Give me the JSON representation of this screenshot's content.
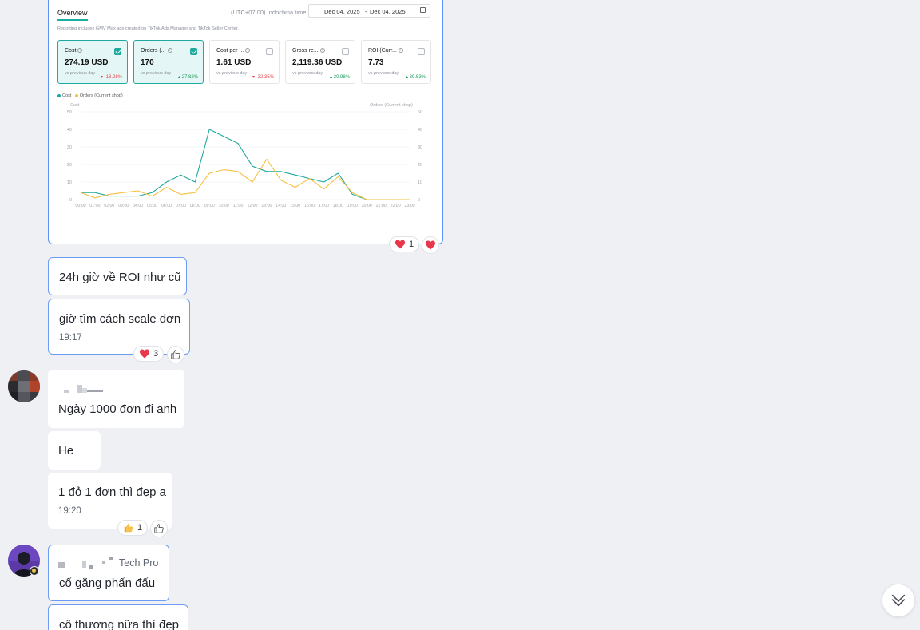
{
  "screenshot_card": {
    "overview_tab": "Overview",
    "timezone": "(UTC+07:00) Indochina time",
    "date_start": "Dec 04, 2025",
    "date_sep": "-",
    "date_end": "Dec 04, 2025",
    "reporting_note": "Reporting includes GMV Max ads created on TikTok Ads Manager and TikTok Seller Center.",
    "metrics": [
      {
        "name": "Cost",
        "value": "274.19 USD",
        "vs": "vs previous day",
        "change": "▾ -13.28%",
        "trend": "down",
        "selected": true
      },
      {
        "name": "Orders (...",
        "value": "170",
        "vs": "vs previous day",
        "change": "▴ 27.82%",
        "trend": "up",
        "selected": true
      },
      {
        "name": "Cost per ...",
        "value": "1.61 USD",
        "vs": "vs previous day",
        "change": "▾ -32.35%",
        "trend": "down",
        "selected": false
      },
      {
        "name": "Gross re...",
        "value": "2,119.36 USD",
        "vs": "vs previous day",
        "change": "▴ 20.98%",
        "trend": "up",
        "selected": false
      },
      {
        "name": "ROI (Curr...",
        "value": "7.73",
        "vs": "vs previous day",
        "change": "▴ 39.53%",
        "trend": "up",
        "selected": false
      }
    ],
    "legend_cost": "Cost",
    "legend_orders": "Orders (Current shop)",
    "left_axis_title": "Cost",
    "right_axis_title": "Orders (Current shop)"
  },
  "chart_data": {
    "type": "line",
    "x": [
      "00:00",
      "01:00",
      "02:00",
      "03:00",
      "04:00",
      "05:00",
      "06:00",
      "07:00",
      "08:00",
      "09:00",
      "10:00",
      "11:00",
      "12:00",
      "13:00",
      "14:00",
      "15:00",
      "16:00",
      "17:00",
      "18:00",
      "19:00",
      "20:00",
      "21:00",
      "22:00",
      "23:00"
    ],
    "series": [
      {
        "name": "Cost",
        "color": "#1fa99e",
        "values": [
          4,
          4,
          2,
          2,
          2,
          4,
          10,
          14,
          10,
          40,
          36,
          32,
          19,
          16,
          16,
          14,
          12,
          10,
          15,
          3,
          0,
          0,
          0,
          0
        ]
      },
      {
        "name": "Orders (Current shop)",
        "color": "#f5c242",
        "values": [
          4,
          1,
          3,
          4,
          5,
          2,
          7,
          3,
          4,
          15,
          17,
          16,
          10,
          23,
          11,
          7,
          12,
          6,
          13,
          4,
          0,
          0,
          0,
          0
        ]
      }
    ],
    "ylim": [
      0,
      50
    ],
    "yticks": [
      0,
      10,
      20,
      30,
      40,
      50
    ],
    "y2lim": [
      0,
      50
    ],
    "y2ticks": [
      0,
      10,
      20,
      30,
      40,
      50
    ],
    "grid": true,
    "legend": "top-left"
  },
  "reactions": {
    "shot_heart_count": "1",
    "msg2_heart_count": "3",
    "msg5_thumb_count": "1"
  },
  "messages": [
    {
      "text": "24h giờ về ROI như cũ"
    },
    {
      "text": "giờ tìm cách scale đơn",
      "time": "19:17"
    },
    {
      "text": "Ngày 1000 đơn đi anh"
    },
    {
      "text": "He"
    },
    {
      "text": "1 đỏ 1 đơn thì đẹp a",
      "time": "19:20"
    },
    {
      "sender_suffix": "Tech Pro",
      "text": "cố gắng phấn đấu"
    },
    {
      "text": "cô thương nữa thì đẹp"
    }
  ],
  "colors": {
    "accent": "#1fa99e",
    "orders_line": "#f5c242",
    "bubble_border": "#6d9cf6",
    "heart": "#e8364b"
  }
}
